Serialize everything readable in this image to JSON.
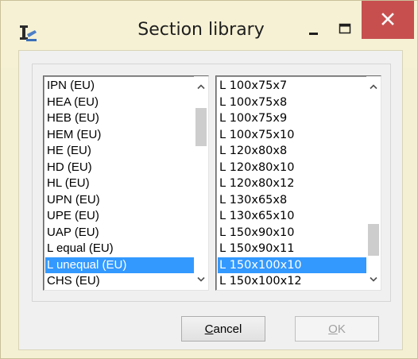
{
  "window": {
    "title": "Section library"
  },
  "left_list": {
    "items": [
      "IPN (EU)",
      "HEA (EU)",
      "HEB (EU)",
      "HEM (EU)",
      "HE (EU)",
      "HD (EU)",
      "HL (EU)",
      "UPN (EU)",
      "UPE (EU)",
      "UAP (EU)",
      "L equal (EU)",
      "L unequal (EU)",
      "CHS (EU)"
    ],
    "selected": "L unequal (EU)"
  },
  "right_list": {
    "items": [
      "L 100x75x7",
      "L 100x75x8",
      "L 100x75x9",
      "L 100x75x10",
      "L 120x80x8",
      "L 120x80x10",
      "L 120x80x12",
      "L 130x65x8",
      "L 130x65x10",
      "L 150x90x10",
      "L 150x90x11",
      "L 150x100x10",
      "L 150x100x12"
    ],
    "selected": "L 150x100x10"
  },
  "buttons": {
    "cancel_mnemonic": "C",
    "cancel_rest": "ancel",
    "ok_mnemonic": "O",
    "ok_rest": "K"
  },
  "colors": {
    "selection": "#3399ff",
    "close_button": "#c7504f",
    "titlebar": "#f6f1d4"
  },
  "icons": {
    "app": "section-library-app-icon",
    "minimize": "minimize-icon",
    "maximize": "maximize-icon",
    "close": "close-icon"
  }
}
